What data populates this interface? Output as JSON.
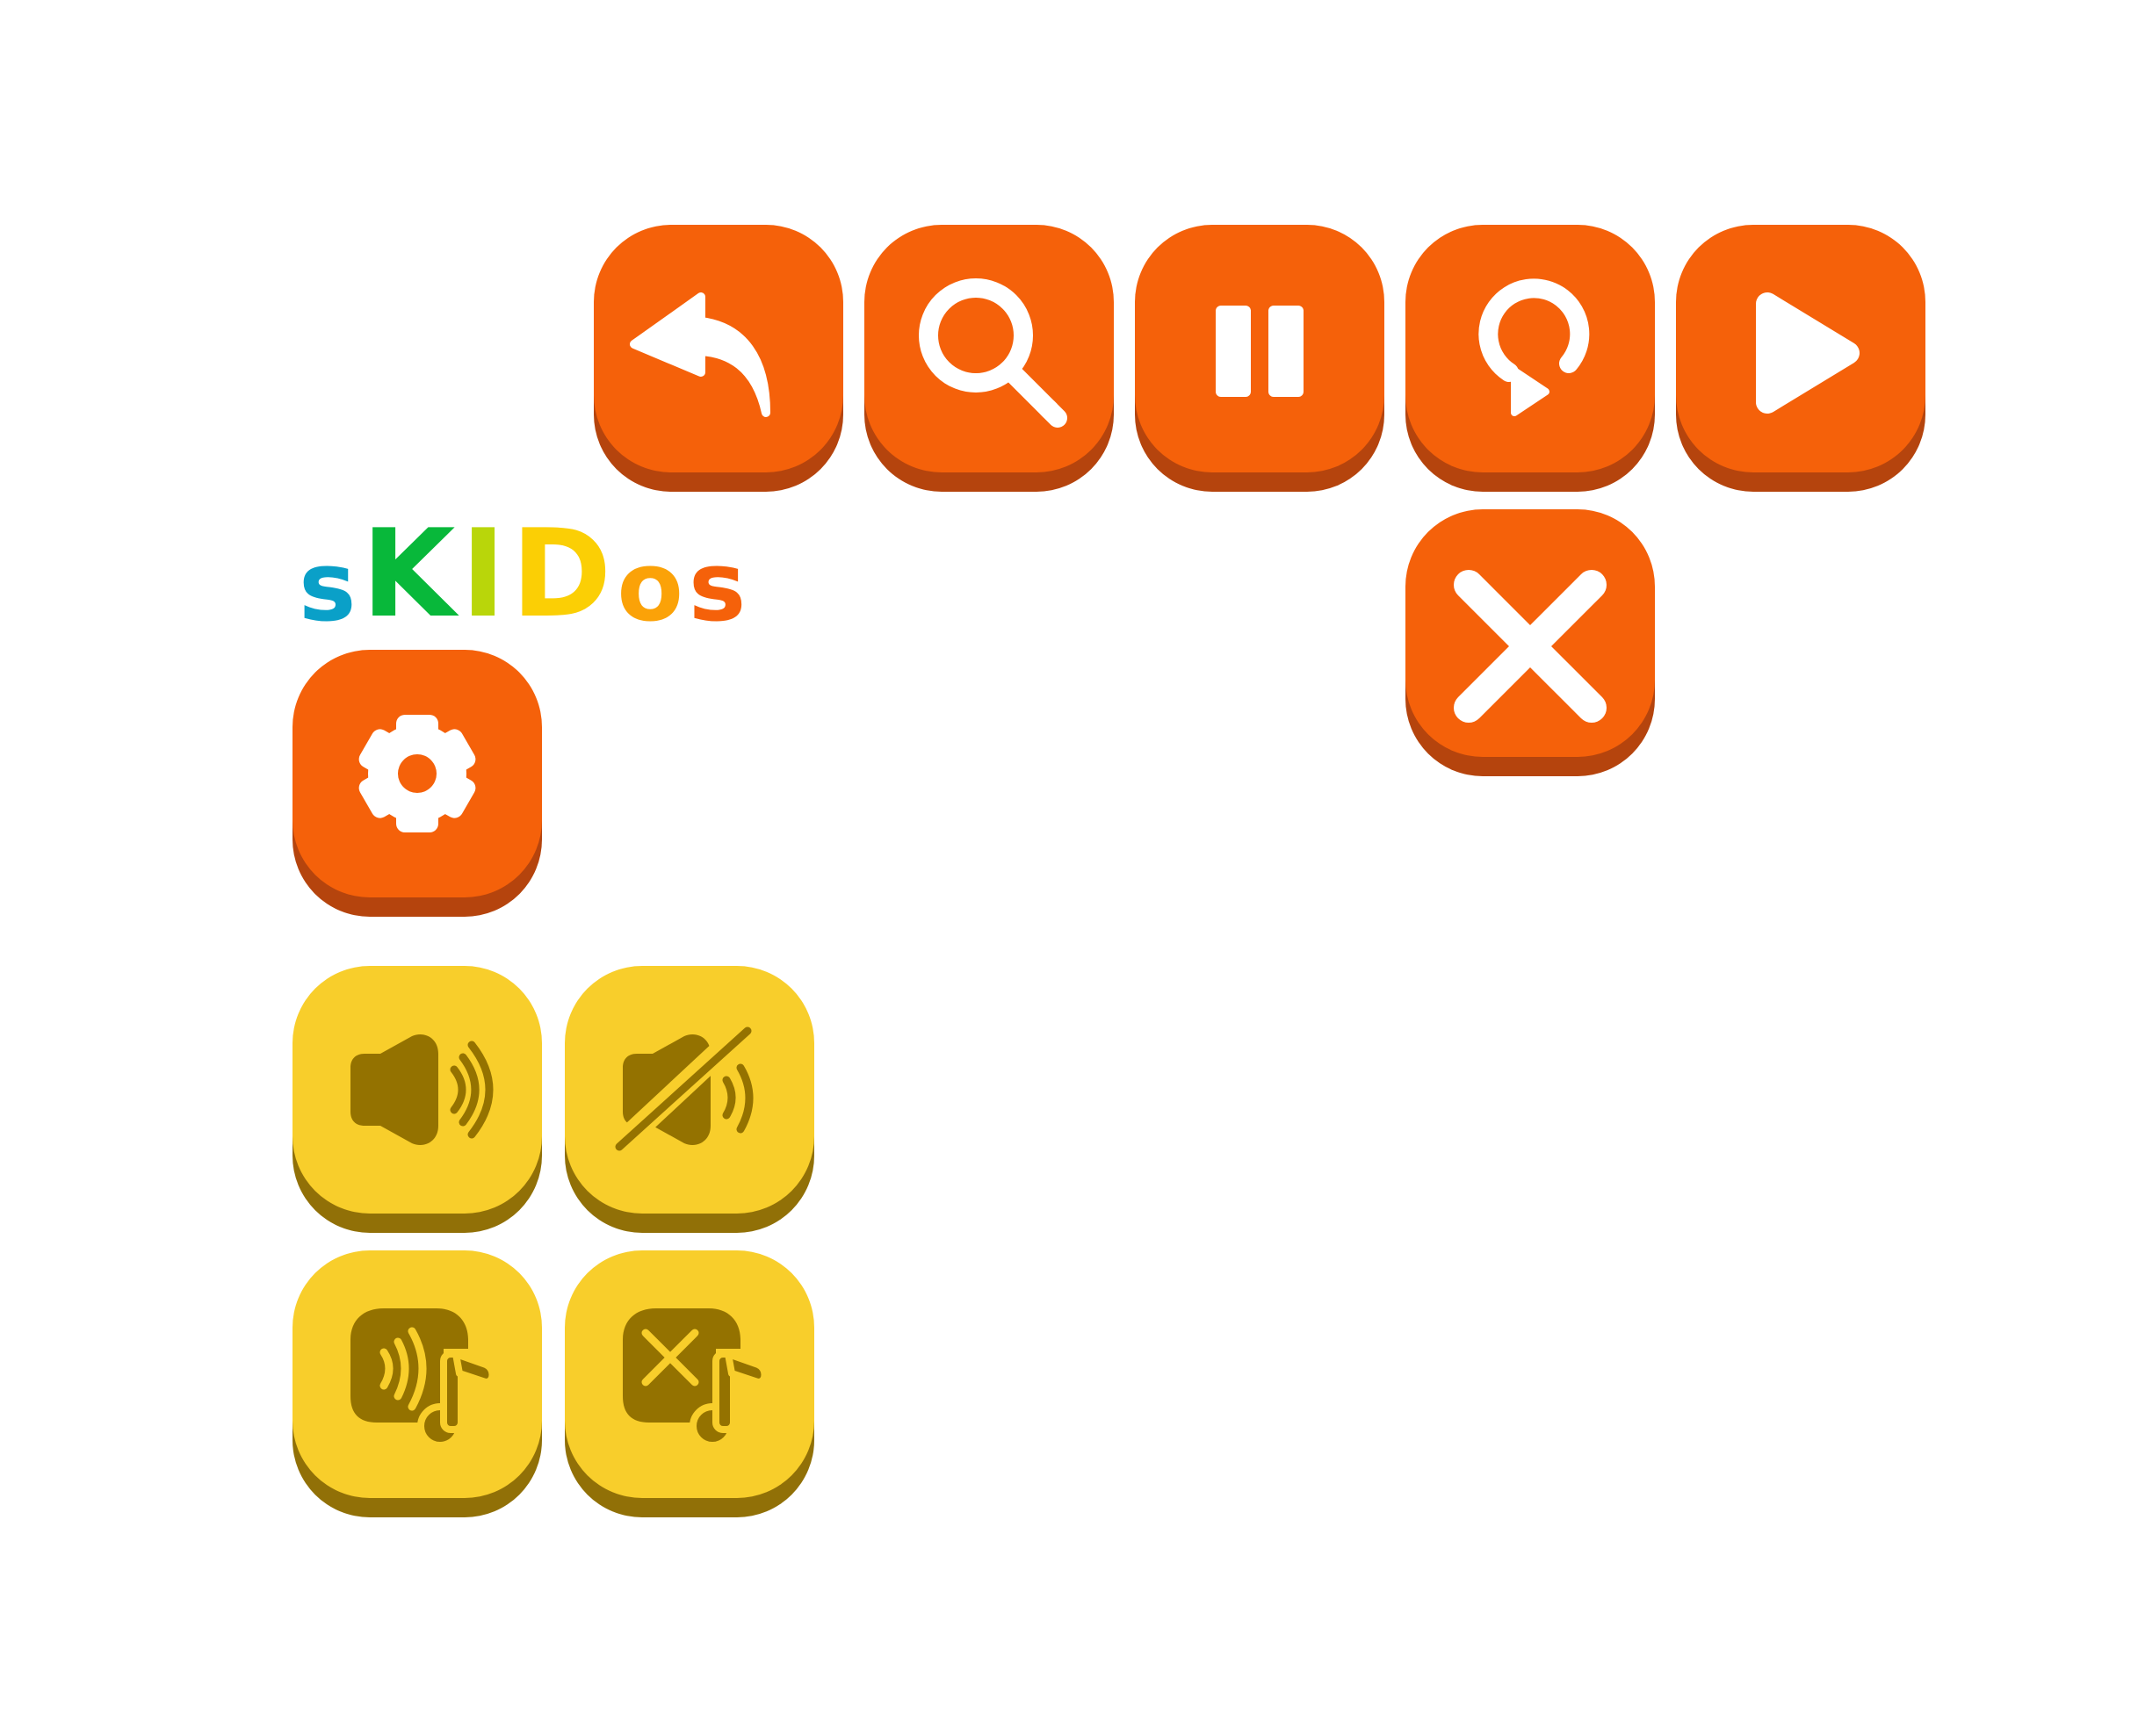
{
  "logo": {
    "letters": [
      {
        "char": "s",
        "color": "#0aa0c8"
      },
      {
        "char": "K",
        "color": "#08b83a"
      },
      {
        "char": "I",
        "color": "#b9d60a"
      },
      {
        "char": "D",
        "color": "#fbcf05"
      },
      {
        "char": "o",
        "color": "#fba208"
      },
      {
        "char": "s",
        "color": "#f5610a"
      }
    ]
  },
  "colors": {
    "orange": "#f5610a",
    "orange_shadow": "#b5440d",
    "yellow": "#f8ce2b",
    "yellow_shadow": "#917007",
    "icon_light": "#ffffff",
    "icon_dark": "#947200"
  },
  "buttons": [
    {
      "name": "back-button",
      "icon": "back-arrow-icon"
    },
    {
      "name": "zoom-button",
      "icon": "magnifier-icon"
    },
    {
      "name": "pause-button",
      "icon": "pause-icon"
    },
    {
      "name": "restart-button",
      "icon": "restart-icon"
    },
    {
      "name": "play-button",
      "icon": "play-icon"
    },
    {
      "name": "close-button",
      "icon": "close-icon"
    },
    {
      "name": "settings-button",
      "icon": "gear-icon"
    },
    {
      "name": "sound-on-button",
      "icon": "speaker-on-icon"
    },
    {
      "name": "sound-off-button",
      "icon": "speaker-muted-icon"
    },
    {
      "name": "voice-music-on-button",
      "icon": "voice-music-on-icon"
    },
    {
      "name": "voice-music-off-button",
      "icon": "voice-music-off-icon"
    }
  ]
}
